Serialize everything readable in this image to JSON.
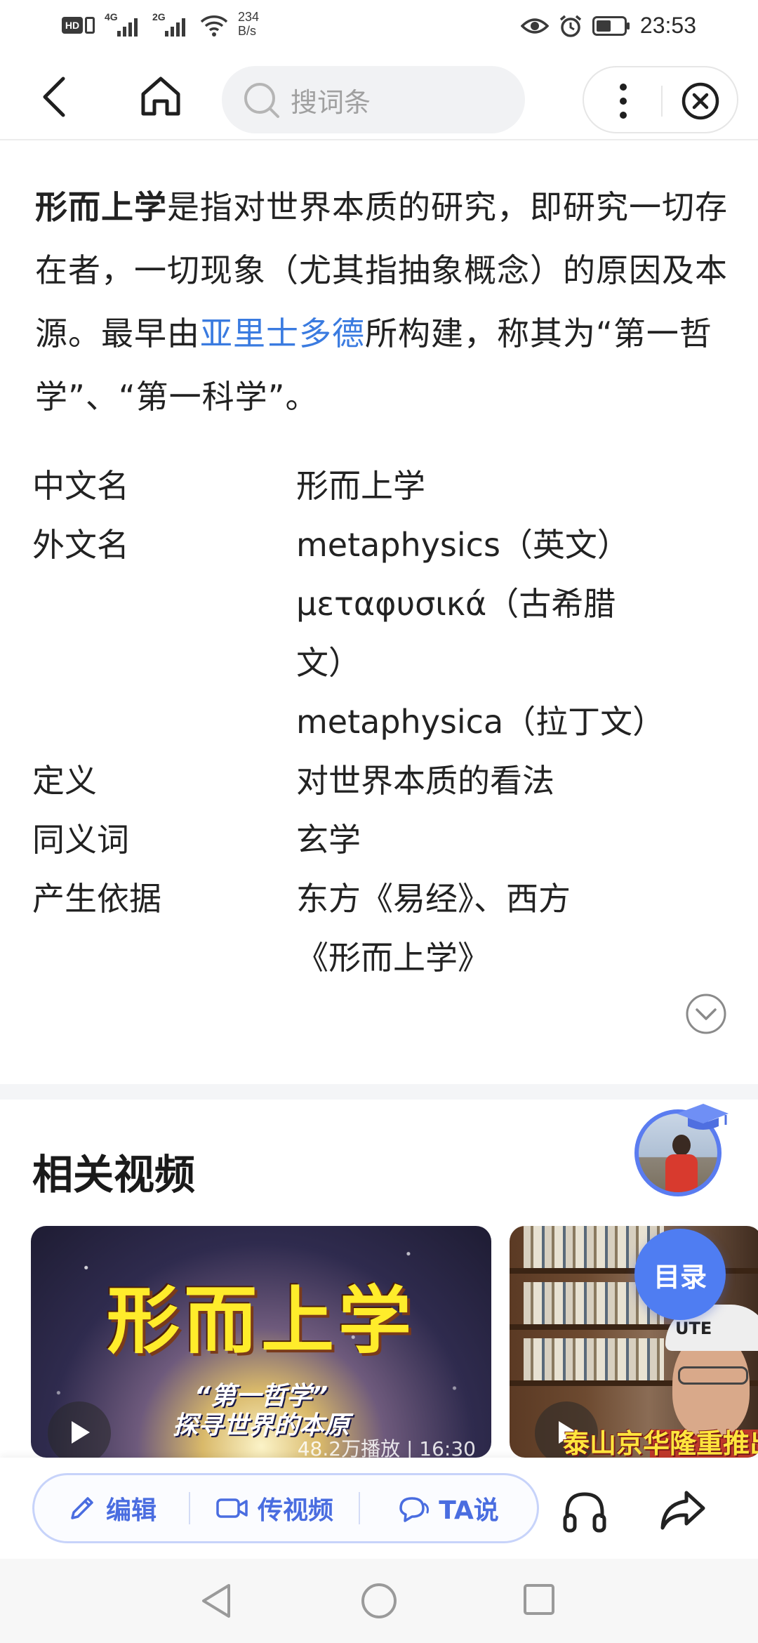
{
  "status_bar": {
    "hd": "HD",
    "signal1": "4G",
    "signal2": "2G",
    "net_speed_value": "234",
    "net_speed_unit": "B/s",
    "time": "23:53"
  },
  "nav": {
    "search_placeholder": "搜词条"
  },
  "summary": {
    "term": "形而上学",
    "text_1": "是指对世界本质的研究，即研究一切存在者，一切现象（尤其指抽象概念）的原因及本源。最早由",
    "link": "亚里士多德",
    "text_2": "所构建，称其为“第一哲学”、“第一科学”。"
  },
  "info": {
    "rows": [
      {
        "label": "中文名",
        "values": [
          "形而上学"
        ]
      },
      {
        "label": "外文名",
        "values": [
          "metaphysics（英文）",
          "μεταφυσικά（古希腊文）",
          "metaphysica（拉丁文）"
        ]
      },
      {
        "label": "定义",
        "values": [
          "对世界本质的看法"
        ]
      },
      {
        "label": "同义词",
        "values": [
          "玄学"
        ]
      },
      {
        "label": "产生依据",
        "values": [
          "东方《易经》、西方《形而上学》"
        ]
      }
    ]
  },
  "related_videos": {
    "title": "相关视频",
    "videos": [
      {
        "title_text": "形而上学",
        "subtitle_line1": "“第一哲学”",
        "subtitle_line2": "探寻世界的本原",
        "meta": "48.2万播放 | 16:30"
      },
      {
        "caption": "泰山京华隆重推出",
        "cap_text": "UTE"
      }
    ]
  },
  "toc_label": "目录",
  "action_bar": {
    "edit_label": "编辑",
    "upload_video_label": "传视频",
    "ta_say_label": "TA说"
  },
  "colors": {
    "link": "#3a7be0",
    "accent": "#4f7df2",
    "action_text": "#4a6de0"
  }
}
